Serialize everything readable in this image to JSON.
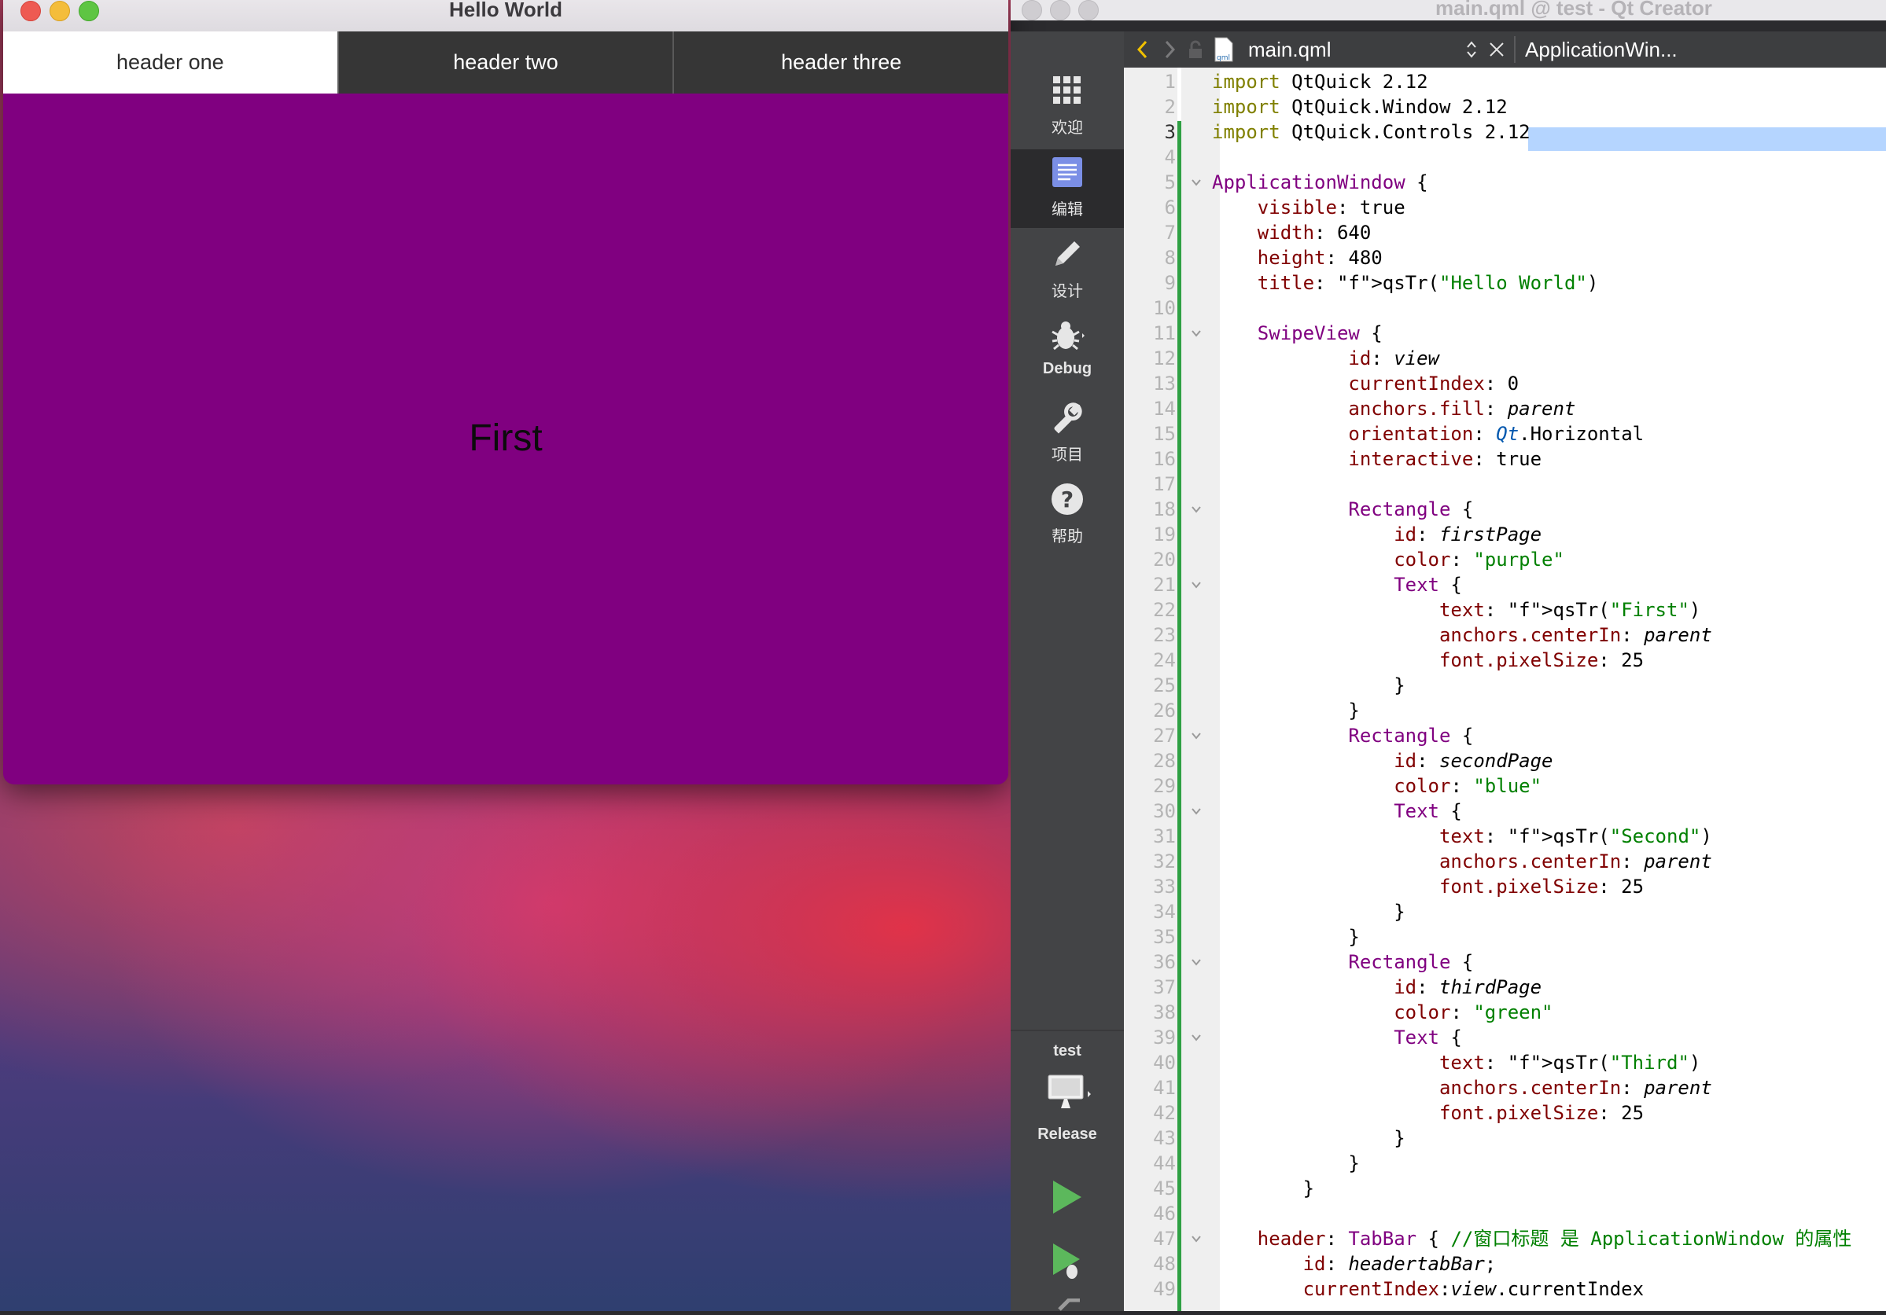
{
  "hello_window": {
    "title": "Hello World",
    "tabs": [
      "header one",
      "header two",
      "header three"
    ],
    "page_text": "First",
    "page_color": "#800080"
  },
  "qt_creator": {
    "title": "main.qml @ test - Qt Creator",
    "toolbar": {
      "file_name": "main.qml",
      "symbol": "ApplicationWin..."
    },
    "modes": [
      {
        "label": "欢迎",
        "icon": "grid-icon"
      },
      {
        "label": "编辑",
        "icon": "document-icon"
      },
      {
        "label": "设计",
        "icon": "pencil-icon"
      },
      {
        "label": "Debug",
        "icon": "bug-icon"
      },
      {
        "label": "项目",
        "icon": "wrench-icon"
      },
      {
        "label": "帮助",
        "icon": "help-icon"
      }
    ],
    "kit": {
      "project": "test",
      "build": "Release"
    },
    "current_line": 3
  },
  "code_lines": [
    "import QtQuick 2.12",
    "import QtQuick.Window 2.12",
    "import QtQuick.Controls 2.12",
    "",
    "ApplicationWindow {",
    "    visible: true",
    "    width: 640",
    "    height: 480",
    "    title: qsTr(\"Hello World\")",
    "",
    "    SwipeView {",
    "            id: view",
    "            currentIndex: 0",
    "            anchors.fill: parent",
    "            orientation: Qt.Horizontal",
    "            interactive: true",
    "",
    "            Rectangle {",
    "                id: firstPage",
    "                color: \"purple\"",
    "                Text {",
    "                    text: qsTr(\"First\")",
    "                    anchors.centerIn: parent",
    "                    font.pixelSize: 25",
    "                }",
    "            }",
    "            Rectangle {",
    "                id: secondPage",
    "                color: \"blue\"",
    "                Text {",
    "                    text: qsTr(\"Second\")",
    "                    anchors.centerIn: parent",
    "                    font.pixelSize: 25",
    "                }",
    "            }",
    "            Rectangle {",
    "                id: thirdPage",
    "                color: \"green\"",
    "                Text {",
    "                    text: qsTr(\"Third\")",
    "                    anchors.centerIn: parent",
    "                    font.pixelSize: 25",
    "                }",
    "            }",
    "        }",
    "",
    "    header: TabBar { //窗口标题 是 ApplicationWindow 的属性",
    "        id: headertabBar;",
    "        currentIndex:view.currentIndex"
  ],
  "fold_lines": [
    5,
    11,
    18,
    21,
    27,
    30,
    36,
    39,
    47
  ]
}
